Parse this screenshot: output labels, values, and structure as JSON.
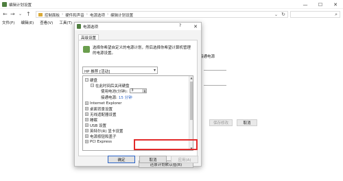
{
  "window": {
    "title": "编辑计划设置",
    "controls": {
      "minimize": "—",
      "maximize": "☐",
      "close": "✕"
    }
  },
  "addressbar": {
    "back": "←",
    "forward": "→",
    "recent": "⌄",
    "up": "↑",
    "breadcrumbs": [
      "控制面板",
      "硬件和声音",
      "电源选项",
      "编辑计划设置"
    ],
    "separator": "›",
    "dropdown": "⌄",
    "refresh": "↻",
    "search_placeholder": "",
    "search_icon": "⌕"
  },
  "menubar": {
    "items": [
      "文件(F)",
      "编辑(E)",
      "查看(V)",
      "工具(T)"
    ]
  },
  "background": {
    "radio_label": "接通电源",
    "save_label": "保存修改",
    "cancel_label": "取消"
  },
  "dialog": {
    "title": "电源选项",
    "help": "?",
    "close": "✕",
    "tab": "高级设置",
    "intro": "选择你希望自定义的电源计划，然后选择你希望计算机管理的电源设置。",
    "plan": "HP 推荐 [活动]",
    "plan_arrow": "▾",
    "tree": [
      {
        "exp": "−",
        "label": "硬盘"
      },
      {
        "exp": "−",
        "label": "在此时间后关闭硬盘"
      },
      {
        "label": "使用电池(分钟):",
        "spin_value": "3"
      },
      {
        "label": "接通电源:",
        "value": "15 分钟"
      },
      {
        "exp": "+",
        "label": "Internet Explorer"
      },
      {
        "exp": "+",
        "label": "桌面背景设置"
      },
      {
        "exp": "+",
        "label": "无线适配器设置"
      },
      {
        "exp": "+",
        "label": "睡眠"
      },
      {
        "exp": "+",
        "label": "USB 设置"
      },
      {
        "exp": "+",
        "label": "英特尔(R) 显卡设置"
      },
      {
        "exp": "+",
        "label": "电源按钮和盖子"
      },
      {
        "exp": "+",
        "label": "PCI Express"
      }
    ],
    "restore_label": "还原计划默认值(R)",
    "ok_label": "确定",
    "cancel_label": "取消",
    "apply_label": "应用(A)"
  },
  "colors": {
    "accent": "#2b63c6",
    "highlight": "#e22b2b",
    "dialog_bg": "#f3f3f3"
  }
}
